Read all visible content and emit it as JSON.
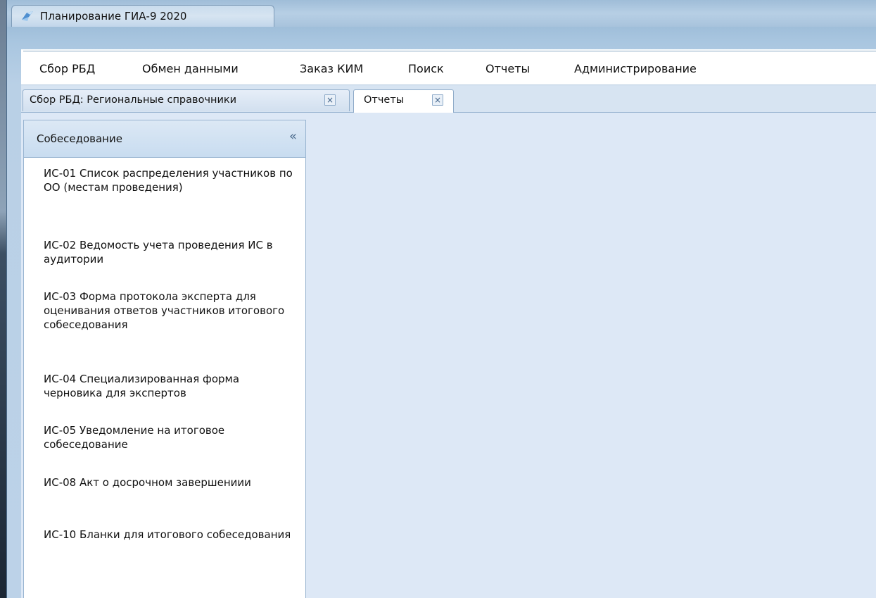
{
  "window": {
    "title": "Планирование ГИА-9 2020",
    "app_icon": "app-logo-icon"
  },
  "menu": {
    "items": [
      "Сбор РБД",
      "Обмен данными",
      "Заказ КИМ",
      "Поиск",
      "Отчеты",
      "Администрирование"
    ]
  },
  "tabs": [
    {
      "label": "Сбор РБД: Региональные справочники",
      "close": "×",
      "active": false
    },
    {
      "label": "Отчеты",
      "close": "×",
      "active": true
    }
  ],
  "sidebar": {
    "header": "Собеседование",
    "collapse_glyph": "«",
    "items": [
      "ИС-01 Список распределения участников по ОО (местам проведения)",
      "ИС-02 Ведомость учета проведения ИС в аудитории",
      "ИС-03 Форма протокола эксперта для оценивания ответов участников итогового собеседования",
      "ИС-04 Специализированная форма черновика для экспертов",
      "ИС-05 Уведомление на итоговое собеседование",
      "ИС-08 Акт о досрочном завершениии",
      "ИС-10 Бланки для итогового собеседования"
    ]
  },
  "colors": {
    "accent": "#3c5f86",
    "panel_bg": "#dde8f6"
  }
}
